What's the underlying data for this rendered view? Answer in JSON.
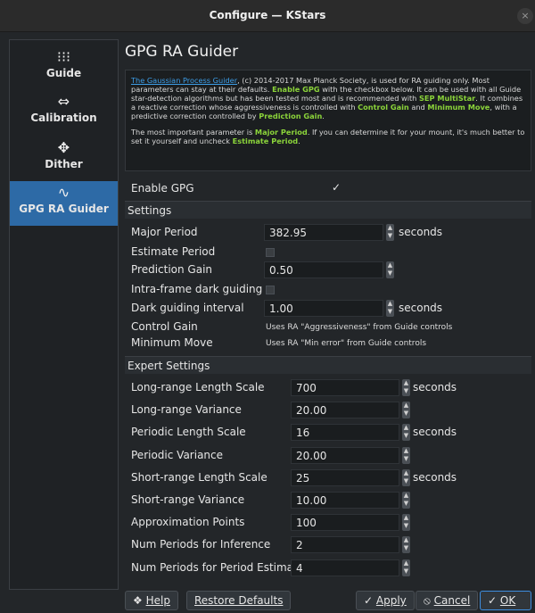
{
  "window": {
    "title": "Configure — KStars",
    "close_glyph": "×"
  },
  "sidebar": {
    "items": [
      {
        "label": "Guide",
        "icon": "grid-dots-icon",
        "glyph": "⁝⁝⁝"
      },
      {
        "label": "Calibration",
        "icon": "ruler-arrows-icon",
        "glyph": "⇔"
      },
      {
        "label": "Dither",
        "icon": "move-arrows-icon",
        "glyph": "✥"
      },
      {
        "label": "GPG RA Guider",
        "icon": "sine-wave-icon",
        "glyph": "∿"
      }
    ]
  },
  "main": {
    "title": "GPG RA Guider",
    "description": {
      "link": "The Gaussian Process Guider",
      "p1_a": ", (c) 2014-2017 Max Planck Society, is used for RA guiding only. Most parameters can stay at their defaults. ",
      "p1_hl1": "Enable GPG",
      "p1_b": " with the checkbox below. It can be used with all Guide star-detection algorithms but has been tested most and is recommended with ",
      "p1_hl2": "SEP MultiStar",
      "p1_c": ". It combines a reactive correction whose aggressiveness is controlled with ",
      "p1_hl3": "Control Gain",
      "p1_d": " and ",
      "p1_hl4": "Minimum Move",
      "p1_e": ", with a predictive correction controlled by ",
      "p1_hl5": "Prediction Gain",
      "p1_f": ".",
      "p2_a": "The most important parameter is ",
      "p2_hl1": "Major Period",
      "p2_b": ". If you can determine it for your mount, it's much better to set it yourself and uncheck ",
      "p2_hl2": "Estimate Period",
      "p2_c": "."
    },
    "enable_gpg": {
      "label": "Enable GPG",
      "checked": true,
      "mark": "✓"
    },
    "settings": {
      "heading": "Settings",
      "major_period": {
        "label": "Major Period",
        "value": "382.95",
        "unit": "seconds"
      },
      "estimate_period": {
        "label": "Estimate Period",
        "checked": false
      },
      "prediction_gain": {
        "label": "Prediction Gain",
        "value": "0.50"
      },
      "intra_frame": {
        "label": "Intra-frame dark guiding",
        "checked": false
      },
      "dark_interval": {
        "label": "Dark guiding interval",
        "value": "1.00",
        "unit": "seconds"
      },
      "control_gain": {
        "label": "Control Gain",
        "note": "Uses RA \"Aggressiveness\" from Guide controls"
      },
      "minimum_move": {
        "label": "Minimum Move",
        "note": "Uses RA \"Min error\" from Guide controls"
      }
    },
    "expert": {
      "heading": "Expert Settings",
      "rows": [
        {
          "label": "Long-range Length Scale",
          "value": "700",
          "unit": "seconds"
        },
        {
          "label": "Long-range Variance",
          "value": "20.00",
          "unit": ""
        },
        {
          "label": "Periodic Length Scale",
          "value": "16",
          "unit": "seconds"
        },
        {
          "label": "Periodic Variance",
          "value": "20.00",
          "unit": ""
        },
        {
          "label": "Short-range Length Scale",
          "value": "25",
          "unit": "seconds"
        },
        {
          "label": "Short-range Variance",
          "value": "10.00",
          "unit": ""
        },
        {
          "label": "Approximation Points",
          "value": "100",
          "unit": ""
        },
        {
          "label": "Num Periods for Inference",
          "value": "2",
          "unit": ""
        },
        {
          "label": "Num Periods for Period Estimate",
          "value": "4",
          "unit": ""
        }
      ]
    }
  },
  "footer": {
    "help": {
      "label": "Help",
      "icon": "help-book-icon",
      "glyph": "❖"
    },
    "restore": {
      "label": "Restore Defaults"
    },
    "apply": {
      "label": "Apply",
      "icon": "check-icon",
      "glyph": "✓"
    },
    "cancel": {
      "label": "Cancel",
      "icon": "cancel-circle-icon",
      "glyph": "⦸"
    },
    "ok": {
      "label": "OK",
      "icon": "check-icon",
      "glyph": "✓"
    }
  }
}
